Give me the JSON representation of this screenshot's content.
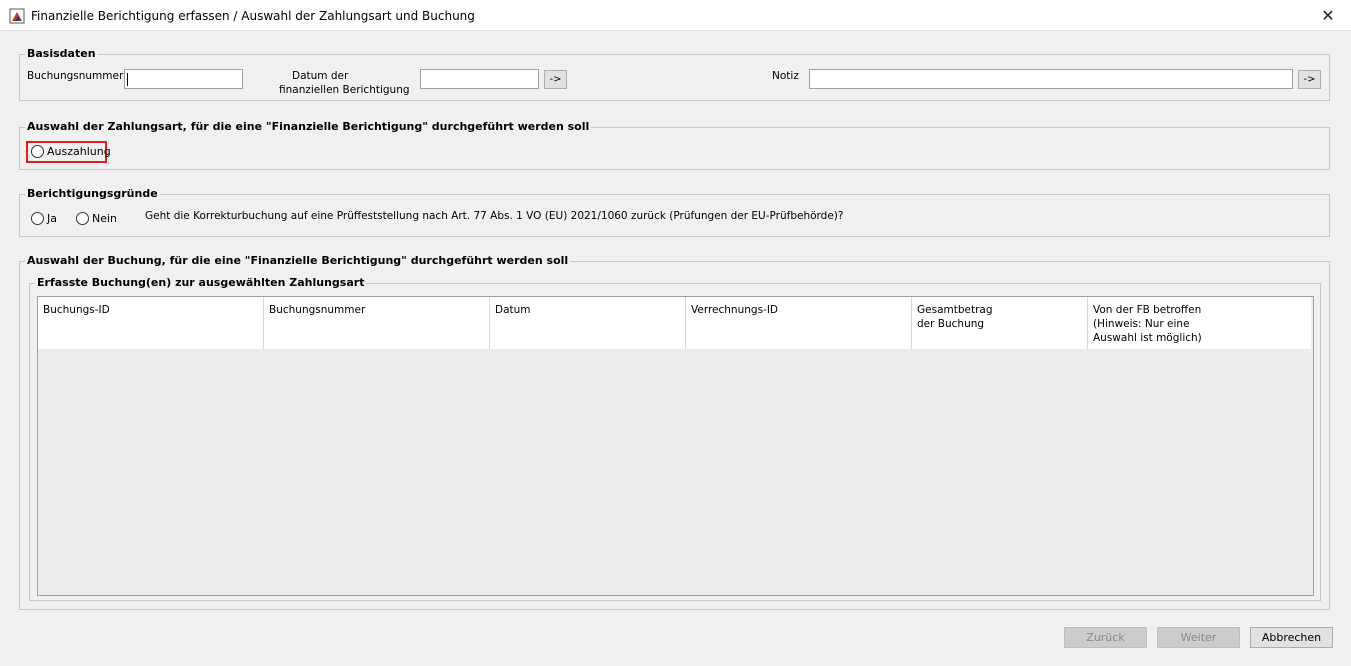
{
  "window": {
    "title": "Finanzielle Berichtigung erfassen / Auswahl der Zahlungsart und Buchung"
  },
  "basisdaten": {
    "title": "Basisdaten",
    "buchungsnummer_label": "Buchungsnummer",
    "buchungsnummer_value": "",
    "datum_label_line1": "Datum der",
    "datum_label_line2": "finanziellen Berichtigung",
    "datum_value": "",
    "datum_button": "->",
    "notiz_label": "Notiz",
    "notiz_value": "",
    "notiz_button": "->"
  },
  "zahlungsart": {
    "title": "Auswahl der Zahlungsart, für die eine \"Finanzielle Berichtigung\" durchgeführt werden soll",
    "option_auszahlung": "Auszahlung"
  },
  "gruende": {
    "title": "Berichtigungsgründe",
    "option_ja": "Ja",
    "option_nein": "Nein",
    "question": "Geht die Korrekturbuchung auf eine Prüffeststellung nach Art. 77 Abs. 1 VO (EU) 2021/1060 zurück (Prüfungen der EU-Prüfbehörde)?"
  },
  "buchung": {
    "title": "Auswahl der Buchung, für die eine \"Finanzielle Berichtigung\" durchgeführt werden soll",
    "subtitle": "Erfasste Buchung(en) zur ausgewählten Zahlungsart",
    "columns": [
      {
        "line1": "Buchungs-ID",
        "line2": "",
        "line3": ""
      },
      {
        "line1": "Buchungsnummer",
        "line2": "",
        "line3": ""
      },
      {
        "line1": "Datum",
        "line2": "",
        "line3": ""
      },
      {
        "line1": "Verrechnungs-ID",
        "line2": "",
        "line3": ""
      },
      {
        "line1": "Gesamtbetrag",
        "line2": "der Buchung",
        "line3": ""
      },
      {
        "line1": "Von der FB betroffen",
        "line2": "(Hinweis: Nur eine",
        "line3": "Auswahl ist möglich)"
      }
    ]
  },
  "footer": {
    "back": "Zurück",
    "next": "Weiter",
    "cancel": "Abbrechen"
  },
  "colors": {
    "highlight": "#e01e25"
  }
}
